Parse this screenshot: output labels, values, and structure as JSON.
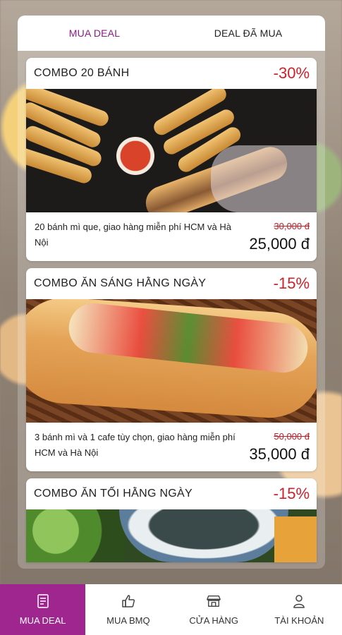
{
  "tabs": [
    {
      "label": "MUA DEAL",
      "active": true
    },
    {
      "label": "DEAL ĐÃ MUA",
      "active": false
    }
  ],
  "deals": [
    {
      "title": "COMBO 20 BÁNH",
      "discount": "-30%",
      "description": "20 bánh mì que, giao hàng miễn phí HCM và Hà Nội",
      "old_price": "30,000 đ",
      "new_price": "25,000 đ"
    },
    {
      "title": "COMBO ĂN SÁNG HẰNG NGÀY",
      "discount": "-15%",
      "description": "3  bánh mì và 1 cafe tùy chọn, giao hàng miễn phí HCM và Hà Nội",
      "old_price": "50,000 đ",
      "new_price": "35,000 đ"
    },
    {
      "title": "COMBO ĂN TỐI HẰNG NGÀY",
      "discount": "-15%"
    }
  ],
  "bottom_nav": [
    {
      "label": "MUA DEAL",
      "icon": "document-icon",
      "active": true
    },
    {
      "label": "MUA BMQ",
      "icon": "thumbs-up-icon",
      "active": false
    },
    {
      "label": "CỬA HÀNG",
      "icon": "store-icon",
      "active": false
    },
    {
      "label": "TÀI KHOẢN",
      "icon": "user-icon",
      "active": false
    }
  ],
  "colors": {
    "accent": "#a0268f",
    "tab_active_text": "#8d1c86",
    "discount": "#d0202a"
  }
}
